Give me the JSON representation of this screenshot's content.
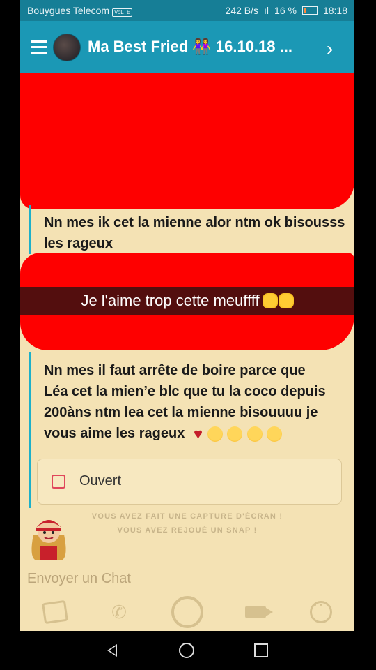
{
  "status_bar": {
    "carrier": "Bouygues Telecom",
    "speed": "242 B/s",
    "battery": "16 %",
    "time": "18:18"
  },
  "header": {
    "title": "Ma Best Fried 👭 16.10.18 ...",
    "next_icon": "chevron-right"
  },
  "messages": {
    "msg1": "Nn mes ik cet la mienne alor ntm ok bisousss les rageux",
    "caption": "Je l'aime trop cette meuffff",
    "msg2": "Nn mes il faut arrête de boire parce que Léa cet la mien’e blc que tu la coco depuis 200àns ntm lea cet la mienne bisouuuu je vous aime  les rageux"
  },
  "open_card": {
    "label": "Ouvert"
  },
  "notices": [
    "VOUS AVEZ FAIT UNE CAPTURE D'ÉCRAN !",
    "VOUS AVEZ REJOUÉ UN SNAP !"
  ],
  "input": {
    "placeholder": "Envoyer un Chat"
  },
  "colors": {
    "header": "#1b98b5",
    "status": "#167e96",
    "chat_bg": "#f4e2b4",
    "redaction": "#fe0000",
    "accent": "#1db0c9"
  },
  "icons": [
    "menu-icon",
    "chevron-right-icon",
    "cards-icon",
    "phone-icon",
    "capture-icon",
    "video-icon",
    "smiley-icon",
    "back-icon",
    "home-icon",
    "recent-apps-icon"
  ]
}
